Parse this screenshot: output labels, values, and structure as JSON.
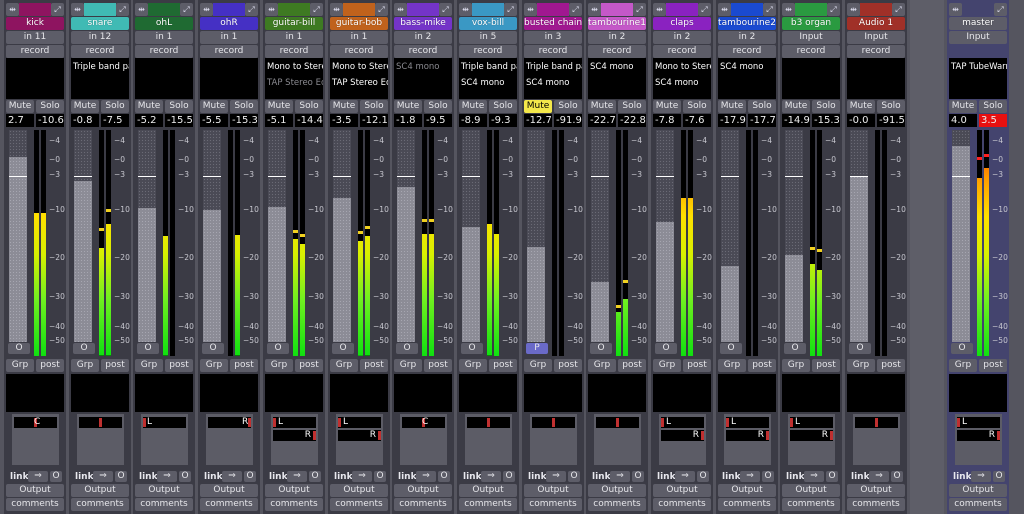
{
  "tick_labels": [
    "4",
    "0",
    "3",
    "10",
    "20",
    "30",
    "40",
    "50"
  ],
  "tick_values": [
    4,
    0,
    -3,
    -10,
    -20,
    -30,
    -40,
    -50
  ],
  "labels": {
    "mute": "Mute",
    "solo": "Solo",
    "record": "record",
    "grp": "Grp",
    "post": "post",
    "link": "link",
    "output": "Output",
    "comments": "comments",
    "link_value": "O",
    "fader_button": "O"
  },
  "icons": {
    "width_toggle": "width-toggle-icon",
    "hide": "hide-strip-icon",
    "link_arrow": "link-arrow-icon"
  },
  "strips": [
    {
      "name": "kick",
      "color": "#8e1460",
      "input": "in 11",
      "plugins": [],
      "gain": "2.7",
      "peak": "-10.6",
      "levels": [
        -10.6,
        -10.6
      ],
      "holds": [
        null,
        null
      ],
      "pan": "mono",
      "pan_label": "C",
      "pan_pos": 0.5
    },
    {
      "name": "snare",
      "color": "#40bab4",
      "input": "in 12",
      "plugins": [
        {
          "name": "Triple band par",
          "active": true
        }
      ],
      "gain": "-0.8",
      "peak": "-7.5",
      "levels": [
        -18,
        -13
      ],
      "holds": [
        -14,
        -10
      ],
      "pan": "mono",
      "pan_label": "",
      "pan_pos": 0.5
    },
    {
      "name": "ohL",
      "color": "#1f6a32",
      "input": "in 1",
      "plugins": [],
      "gain": "-5.2",
      "peak": "-15.5",
      "levels": [
        -15.5,
        null
      ],
      "holds": [
        null,
        null
      ],
      "pan": "mono",
      "pan_label": "L",
      "pan_pos": 0
    },
    {
      "name": "ohR",
      "color": "#4530c4",
      "input": "in 1",
      "plugins": [],
      "gain": "-5.5",
      "peak": "-15.3",
      "levels": [
        null,
        -15.3
      ],
      "holds": [
        null,
        null
      ],
      "pan": "mono",
      "pan_label": "R",
      "pan_pos": 1
    },
    {
      "name": "guitar-bill",
      "color": "#3e7a22",
      "input": "in 1",
      "plugins": [
        {
          "name": "Mono to Stereo",
          "active": true
        },
        {
          "name": "TAP Stereo Echo",
          "active": false
        }
      ],
      "gain": "-5.1",
      "peak": "-14.4",
      "levels": [
        -16,
        -17
      ],
      "holds": [
        -14.4,
        -15.3
      ],
      "pan": "stereo",
      "pan_pos": 0.5
    },
    {
      "name": "guitar-bob",
      "color": "#c0621c",
      "input": "in 1",
      "plugins": [
        {
          "name": "Mono to Stereo",
          "active": true
        },
        {
          "name": "TAP Stereo Echo",
          "active": true
        }
      ],
      "gain": "-3.5",
      "peak": "-12.1",
      "levels": [
        -16.5,
        -15.5
      ],
      "holds": [
        -14.5,
        -13.5
      ],
      "pan": "stereo",
      "pan_pos": 0.5
    },
    {
      "name": "bass-mike",
      "color": "#7434c8",
      "input": "in 2",
      "plugins": [
        {
          "name": "SC4 mono",
          "active": false
        }
      ],
      "gain": "-1.8",
      "peak": "-9.5",
      "levels": [
        -15,
        -15
      ],
      "holds": [
        -12,
        -12
      ],
      "pan": "mono",
      "pan_label": "C",
      "pan_pos": 0.5
    },
    {
      "name": "vox-bill",
      "color": "#3a98c4",
      "input": "in 5",
      "plugins": [
        {
          "name": "Triple band par",
          "active": true
        },
        {
          "name": "SC4 mono",
          "active": true
        }
      ],
      "gain": "-8.9",
      "peak": "-9.3",
      "levels": [
        -13,
        -15
      ],
      "holds": [
        null,
        null
      ],
      "pan": "mono",
      "pan_label": "",
      "pan_pos": 0.5
    },
    {
      "name": "busted chain",
      "color": "#a01890",
      "input": "in 3",
      "plugins": [
        {
          "name": "Triple band par",
          "active": true
        },
        {
          "name": "SC4 mono",
          "active": true
        }
      ],
      "gain": "-12.7",
      "peak": "-91.9",
      "levels": [
        null,
        null
      ],
      "holds": [
        null,
        null
      ],
      "pan": "mono",
      "pan_label": "",
      "pan_pos": 0.5,
      "muted": true,
      "fader_button": "P"
    },
    {
      "name": "tambourine1",
      "color": "#c458c8",
      "input": "in 2",
      "plugins": [
        {
          "name": "SC4 mono",
          "active": true
        }
      ],
      "gain": "-22.7",
      "peak": "-22.8",
      "levels": [
        -35,
        -30.5
      ],
      "holds": [
        -33,
        -26
      ],
      "pan": "mono",
      "pan_label": "",
      "pan_pos": 0.5
    },
    {
      "name": "claps",
      "color": "#8a22c0",
      "input": "in 2",
      "plugins": [
        {
          "name": "Mono to Stereo",
          "active": true
        },
        {
          "name": "SC4 mono",
          "active": true
        }
      ],
      "gain": "-7.8",
      "peak": "-7.6",
      "levels": [
        -7.6,
        -7.6
      ],
      "holds": [
        null,
        null
      ],
      "pan": "stereo",
      "pan_pos": 0.5
    },
    {
      "name": "tambourine2",
      "color": "#1a4ad0",
      "input": "in 2",
      "plugins": [
        {
          "name": "SC4 mono",
          "active": true
        }
      ],
      "gain": "-17.9",
      "peak": "-17.7",
      "levels": [
        null,
        null
      ],
      "holds": [
        null,
        null
      ],
      "pan": "stereo",
      "pan_pos": 0.5
    },
    {
      "name": "b3 organ",
      "color": "#2a9a40",
      "input": "Input",
      "plugins": [],
      "gain": "-14.9",
      "peak": "-15.3",
      "levels": [
        -21.5,
        -23
      ],
      "holds": [
        -18,
        -18.3
      ],
      "pan": "stereo",
      "pan_pos": 0.5
    },
    {
      "name": "Audio 1",
      "color": "#a03028",
      "input": "Input",
      "plugins": [],
      "gain": "-0.0",
      "peak": "-91.5",
      "levels": [
        null,
        null
      ],
      "holds": [
        null,
        null
      ],
      "pan": "mono",
      "pan_label": "",
      "pan_pos": 0.5
    }
  ],
  "master": {
    "name": "master",
    "input": "Input",
    "plugins": [
      {
        "name": "TAP TubeWarmth",
        "active": true
      }
    ],
    "gain": "4.0",
    "peak": "3.5",
    "peak_color": "#e81010",
    "levels": [
      -3.5,
      -1.5
    ],
    "holds": [
      0.5,
      1.0
    ],
    "pan": "stereo"
  }
}
